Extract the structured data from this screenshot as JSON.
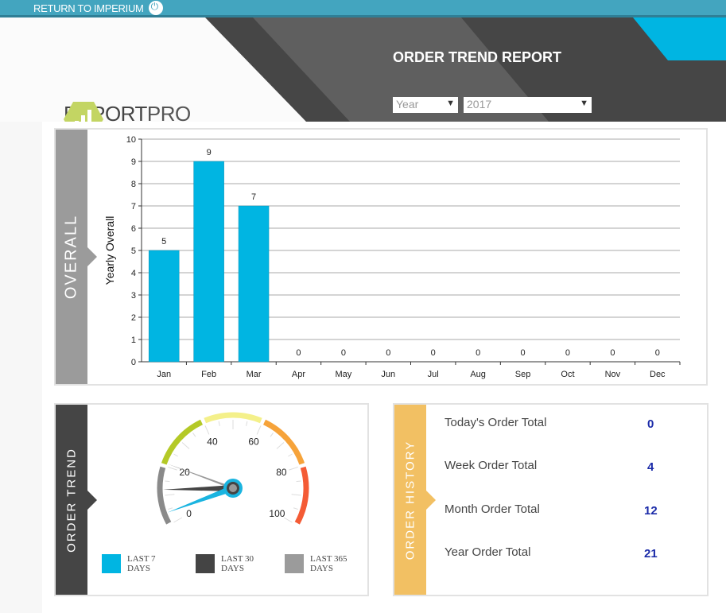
{
  "topbar": {
    "return_label": "RETURN TO IMPERIUM",
    "icon": "power-icon"
  },
  "header": {
    "title": "ORDER TREND REPORT",
    "logo": {
      "bold": "REPORT",
      "light": "PRO"
    },
    "period_select": {
      "value": "Year"
    },
    "year_select": {
      "value": "2017"
    }
  },
  "colors": {
    "accent": "#00b5e2",
    "topbar": "#43a5bf",
    "overall_side": "#9b9b9b",
    "trend_side": "#454545",
    "history_side": "#f2c063"
  },
  "overall": {
    "side_label": "OVERALL"
  },
  "chart_data": {
    "type": "bar",
    "categories": [
      "Jan",
      "Feb",
      "Mar",
      "Apr",
      "May",
      "Jun",
      "Jul",
      "Aug",
      "Sep",
      "Oct",
      "Nov",
      "Dec"
    ],
    "values": [
      5,
      9,
      7,
      0,
      0,
      0,
      0,
      0,
      0,
      0,
      0,
      0
    ],
    "ylabel": "Yearly Overall",
    "ylim": [
      0,
      10
    ],
    "yticks": [
      0,
      1,
      2,
      3,
      4,
      5,
      6,
      7,
      8,
      9,
      10
    ],
    "grid": true,
    "color": "#00b5e2"
  },
  "order_trend": {
    "side_label": "ORDER TREND",
    "gauge": {
      "min": 0,
      "max": 100,
      "tick_labels": [
        "0",
        "20",
        "40",
        "60",
        "80",
        "100"
      ],
      "needles": [
        {
          "name": "LAST 7 DAYS",
          "value": 4,
          "color": "#1ab4e0"
        },
        {
          "name": "LAST 30 DAYS",
          "value": 12,
          "color": "#444444"
        },
        {
          "name": "LAST 365 DAYS",
          "value": 21,
          "color": "#999999"
        }
      ],
      "bands": [
        {
          "from": 0,
          "to": 20,
          "color": "#8a8a8a"
        },
        {
          "from": 20,
          "to": 40,
          "color": "#b4c927"
        },
        {
          "from": 40,
          "to": 60,
          "color": "#f4f08a"
        },
        {
          "from": 60,
          "to": 80,
          "color": "#f6a33a"
        },
        {
          "from": 80,
          "to": 100,
          "color": "#f45b35"
        }
      ]
    },
    "legend": [
      {
        "line1": "LAST 7",
        "line2": "DAYS",
        "color": "#00b5e2"
      },
      {
        "line1": "LAST 30",
        "line2": "DAYS",
        "color": "#444444"
      },
      {
        "line1": "LAST 365",
        "line2": "DAYS",
        "color": "#9b9b9b"
      }
    ]
  },
  "order_history": {
    "side_label": "ORDER HISTORY",
    "rows": [
      {
        "label": "Today's Order Total",
        "value": "0"
      },
      {
        "label": "Week Order Total",
        "value": "4"
      },
      {
        "label": "Month Order Total",
        "value": "12"
      },
      {
        "label": "Year Order Total",
        "value": "21"
      }
    ]
  }
}
